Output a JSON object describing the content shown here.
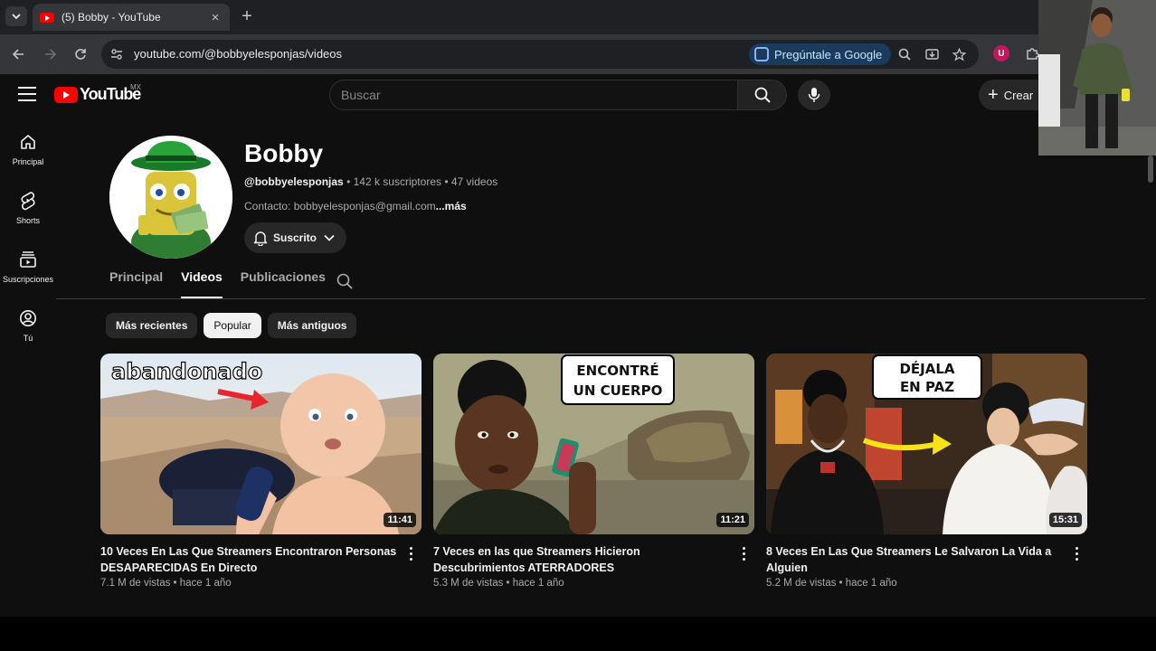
{
  "browser": {
    "tab_title": "(5) Bobby - YouTube",
    "tab_close": "×",
    "new_tab": "+",
    "url": "youtube.com/@bobbyelesponjas/videos",
    "ask_google": "Pregúntale a Google",
    "profile_initial": "U"
  },
  "youtube": {
    "logo_text": "YouTube",
    "region": "MX",
    "search_placeholder": "Buscar",
    "create_label": "Crear",
    "sidebar": [
      {
        "label": "Principal",
        "icon": "home-icon"
      },
      {
        "label": "Shorts",
        "icon": "shorts-icon"
      },
      {
        "label": "Suscripciones",
        "icon": "subscriptions-icon"
      },
      {
        "label": "Tú",
        "icon": "you-icon"
      }
    ],
    "channel": {
      "name": "Bobby",
      "handle": "@bobbyelesponjas",
      "subscribers": "142 k suscriptores",
      "videos_count": "47 videos",
      "separator": " • ",
      "contact": "Contacto: bobbyelesponjas@gmail.com",
      "more": "...más",
      "subscribe_label": "Suscrito"
    },
    "tabs": [
      "Principal",
      "Videos",
      "Publicaciones"
    ],
    "active_tab": "Videos",
    "chips": [
      "Más recientes",
      "Popular",
      "Más antiguos"
    ],
    "active_chip": "Popular",
    "videos": [
      {
        "title": "10 Veces En Las Que Streamers Encontraron Personas DESAPARECIDAS En Directo",
        "views": "7.1 M de vistas",
        "age": "hace 1 año",
        "duration": "11:41",
        "thumb_text": "abandonado"
      },
      {
        "title": "7 Veces en las que Streamers Hicieron Descubrimientos ATERRADORES",
        "views": "5.3 M de vistas",
        "age": "hace 1 año",
        "duration": "11:21",
        "thumb_text_1": "ENCONTRÉ",
        "thumb_text_2": "UN CUERPO"
      },
      {
        "title": "8 Veces En Las Que Streamers Le Salvaron La Vida a Alguien",
        "views": "5.2 M de vistas",
        "age": "hace 1 año",
        "duration": "15:31",
        "thumb_text_1": "DÉJALA",
        "thumb_text_2": "EN PAZ"
      }
    ]
  },
  "colors": {
    "youtube_bg": "#0f0f0f",
    "youtube_red": "#ff0000",
    "chrome_bg": "#35363a",
    "ask_google_bg": "#1b3a5c",
    "arrow_red": "#e8242c",
    "arrow_yellow": "#f7e21a"
  }
}
